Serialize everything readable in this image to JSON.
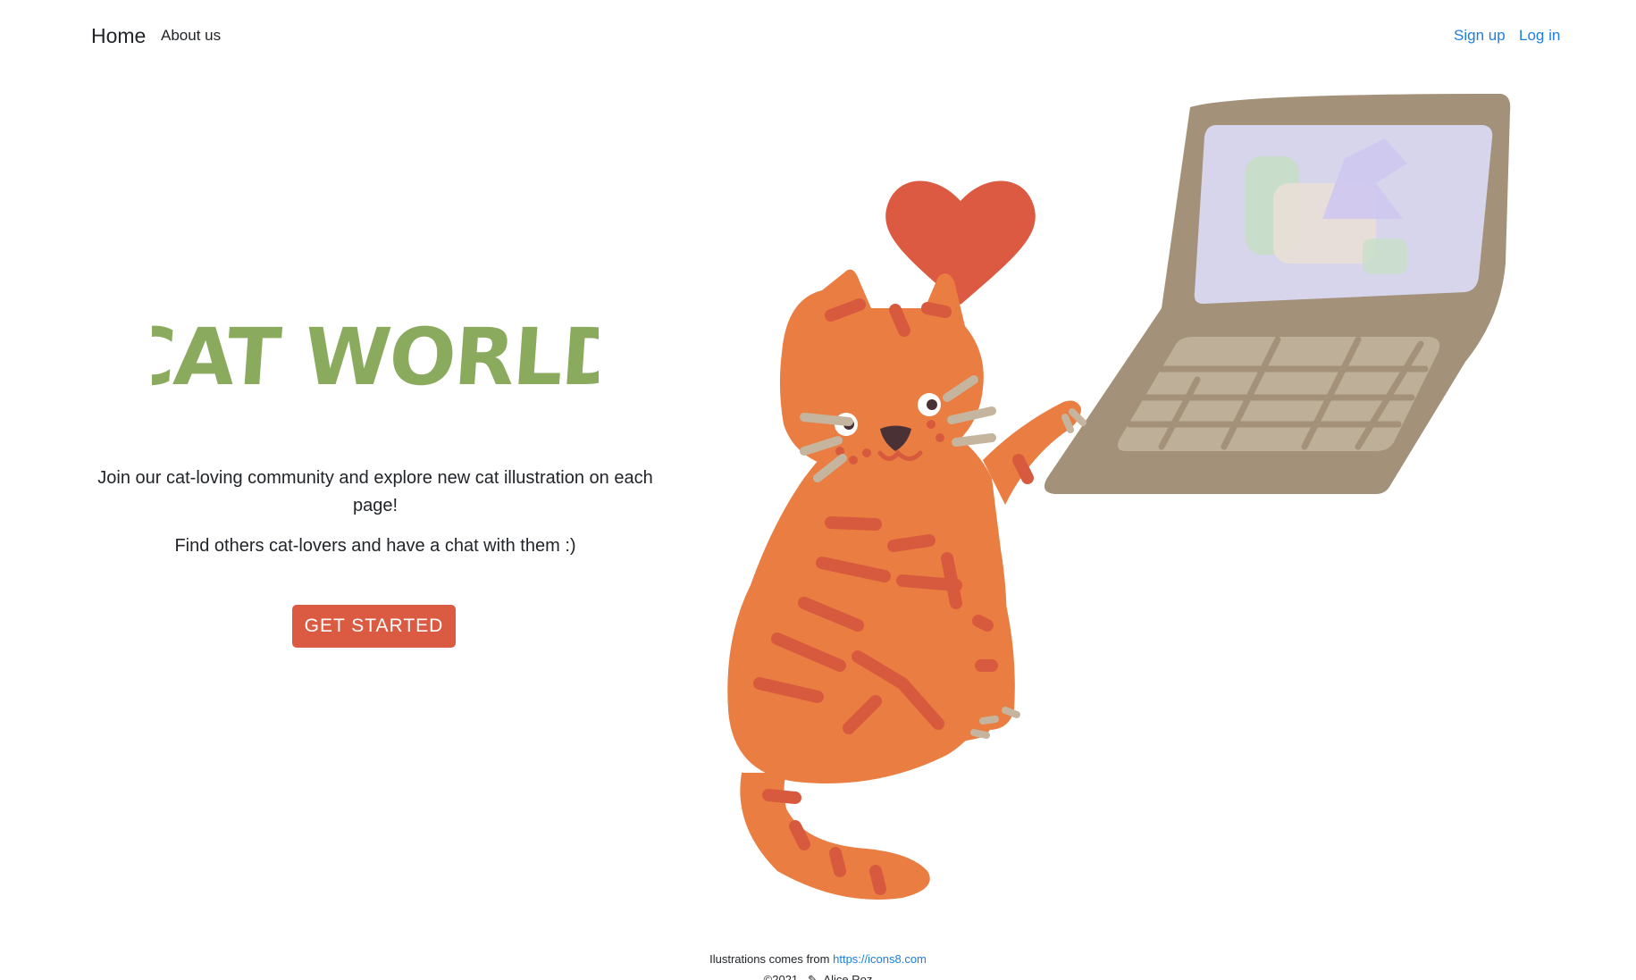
{
  "nav": {
    "home_label": "Home",
    "about_label": "About us",
    "signup_label": "Sign up",
    "login_label": "Log in"
  },
  "hero": {
    "title": "CAT WORLD",
    "description": "Join our cat-loving community and explore new cat illustration on each page!",
    "description2": "Find others cat-lovers and have a chat with them :)",
    "cta_label": "GET STARTED"
  },
  "footer": {
    "credit_prefix": "Ilustrations comes from",
    "credit_link": "https://icons8.com",
    "copyright": "©2021",
    "author": "Alice Roz"
  },
  "colors": {
    "title_green": "#8aab5e",
    "cta_red": "#db5b42",
    "link_blue": "#1e7fe0",
    "cat_orange": "#ea7d42",
    "stripe_red": "#d85a3e",
    "laptop_brown": "#a39179",
    "screen_lavender": "#d6d5ec",
    "heart_red": "#dc5a42"
  },
  "icons": [
    "cat-illustration",
    "heart-icon",
    "laptop-illustration",
    "signature-icon"
  ]
}
